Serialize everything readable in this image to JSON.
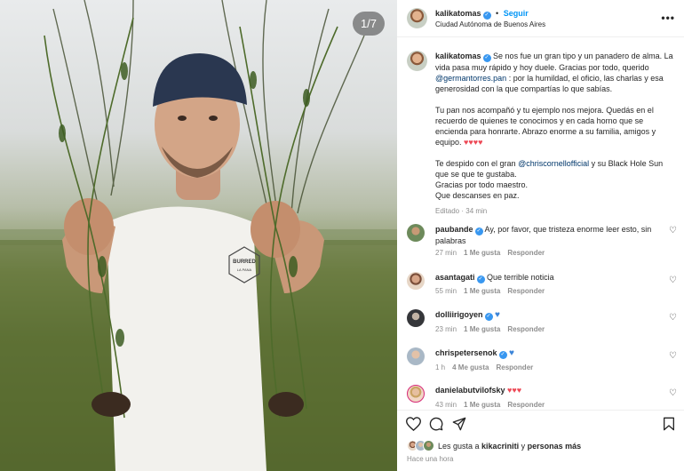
{
  "photo": {
    "counter": "1/7",
    "shirt_logo_line1": "BURRED",
    "shirt_logo_line2": "LA PANA"
  },
  "header": {
    "username": "kalikatomas",
    "dot": "•",
    "follow_label": "Seguir",
    "location": "Ciudad Autónoma de Buenos Aires",
    "more_icon": "more-horizontal-icon"
  },
  "caption": {
    "username": "kalikatomas",
    "p1_before": "Se nos fue un gran tipo y un panadero de alma. La vida pasa muy rápido y hoy duele. Gracias por todo, querido ",
    "p1_mention": "@germantorres.pan",
    "p1_after": " : por la humildad, el oficio, las charlas y esa generosidad con la que compartías lo que sabías.",
    "p2": "Tu pan nos acompañó y tu ejemplo nos mejora. Quedás en el recuerdo de quienes te conocimos y en cada horno que se encienda para honrarte. Abrazo enorme a su familia, amigos y equipo.",
    "p2_hearts": "♥♥♥♥",
    "p3_before": "Te despido con el gran ",
    "p3_mention": "@chriscornellofficial",
    "p3_after": " y su Black Hole Sun que se que te gustaba.",
    "p3_line2": "Gracias por todo maestro.",
    "p3_line3": "Que descanses en paz.",
    "edited": "Editado · 34 min"
  },
  "comments": [
    {
      "username": "paubande",
      "text": "Ay, por favor, que tristeza enorme leer esto, sin palabras",
      "time": "27 min",
      "likes": "1 Me gusta",
      "reply": "Responder"
    },
    {
      "username": "asantagati",
      "text": "Que terrible noticia",
      "time": "55 min",
      "likes": "1 Me gusta",
      "reply": "Responder"
    },
    {
      "username": "dolliirigoyen",
      "text": "♥",
      "time": "23 min",
      "likes": "1 Me gusta",
      "reply": "Responder"
    },
    {
      "username": "chrispetersenok",
      "text": "♥",
      "time": "1 h",
      "likes": "4 Me gusta",
      "reply": "Responder"
    },
    {
      "username": "danielabutvilofsky",
      "text": "♥♥♥",
      "time": "43 min",
      "likes": "1 Me gusta",
      "reply": "Responder"
    }
  ],
  "footer": {
    "likes_prefix": "Les gusta a ",
    "likes_user": "kikacriniti",
    "likes_mid": " y ",
    "likes_rest": "personas más",
    "posted": "Hace una hora"
  },
  "colors": {
    "accent": "#0095f6",
    "heart": "#ed4956",
    "verified": "#3897f0"
  }
}
